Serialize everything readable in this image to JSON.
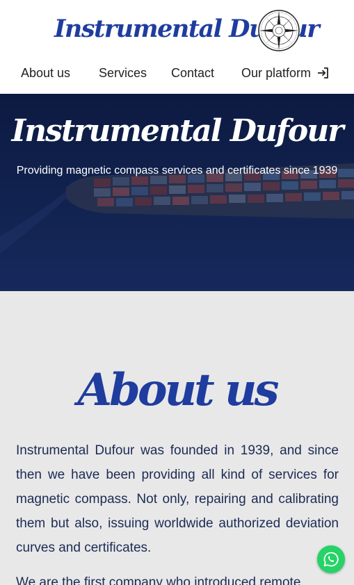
{
  "header": {
    "brand": "Instrumental Dufour",
    "logo_icon": "compass-rose-icon",
    "nav": [
      {
        "label": "About us"
      },
      {
        "label": "Services"
      },
      {
        "label": "Contact"
      },
      {
        "label": "Our platform"
      }
    ],
    "login_icon": "login-arrow-icon"
  },
  "hero": {
    "title": "Instrumental Dufour",
    "subtitle": "Providing magnetic compass services and certificates since 1939"
  },
  "about": {
    "heading": "About us",
    "paragraphs": [
      "Instrumental Dufour was founded in 1939, and since then we have been providing all kind of services for magnetic compass. Not only, repairing and calibrating them but also, issuing worldwide authorized deviation curves and certificates.",
      "We are the first company who introduced remote"
    ]
  },
  "whatsapp_icon": "whatsapp-icon",
  "colors": {
    "brand_blue": "#1f3d9e",
    "hero_navy": "#14275a",
    "section_gray": "#e8e8e9",
    "whatsapp_green": "#25d366"
  }
}
